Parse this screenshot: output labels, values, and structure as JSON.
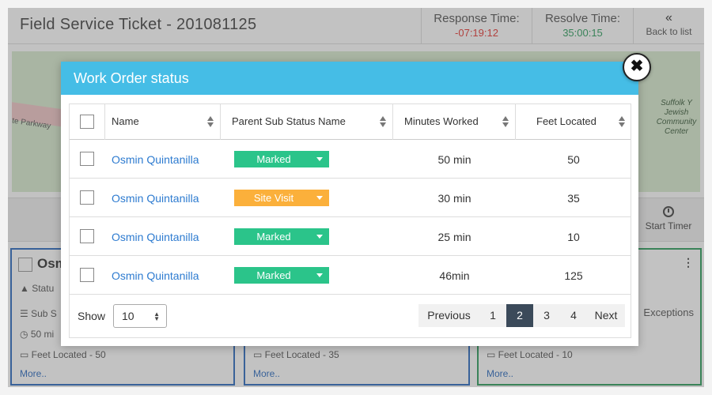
{
  "app": {
    "title": "Field Service Ticket - 201081125",
    "response_label": "Response Time:",
    "response_value": "-07:19:12",
    "resolve_label": "Resolve Time:",
    "resolve_value": "35:00:15",
    "back_label": "Back to list",
    "start_timer_label": "Start Timer",
    "map_street": "te Parkway",
    "map_poi": "Suffolk Y Jewish Community Center"
  },
  "cards": [
    {
      "name": "Osm",
      "status_prefix": "Statu",
      "sub_prefix": "Sub S",
      "minutes": "50 mi",
      "feet": "Feet Located - 50",
      "more": "More.."
    },
    {
      "feet": "Feet Located - 35",
      "more": "More.."
    },
    {
      "feet": "Feet Located - 10",
      "more": "More..",
      "exceptions": "Exceptions"
    }
  ],
  "modal": {
    "title": "Work Order status",
    "close_symbol": "✖"
  },
  "table": {
    "headers": {
      "name": "Name",
      "status": "Parent Sub Status Name",
      "minutes": "Minutes Worked",
      "feet": "Feet Located"
    },
    "rows": [
      {
        "name": "Osmin Quintanilla",
        "status": "Marked",
        "status_color": "#2bc48a",
        "minutes": "50 min",
        "feet": "50"
      },
      {
        "name": "Osmin Quintanilla",
        "status": "Site Visit",
        "status_color": "#fbb03b",
        "minutes": "30 min",
        "feet": "35"
      },
      {
        "name": "Osmin Quintanilla",
        "status": "Marked",
        "status_color": "#2bc48a",
        "minutes": "25 min",
        "feet": "10"
      },
      {
        "name": "Osmin Quintanilla",
        "status": "Marked",
        "status_color": "#2bc48a",
        "minutes": "46min",
        "feet": "125"
      }
    ],
    "show_label": "Show",
    "page_size": "10",
    "pagination": {
      "previous": "Previous",
      "pages": [
        "1",
        "2",
        "3",
        "4"
      ],
      "current_page": "2",
      "next": "Next"
    }
  }
}
